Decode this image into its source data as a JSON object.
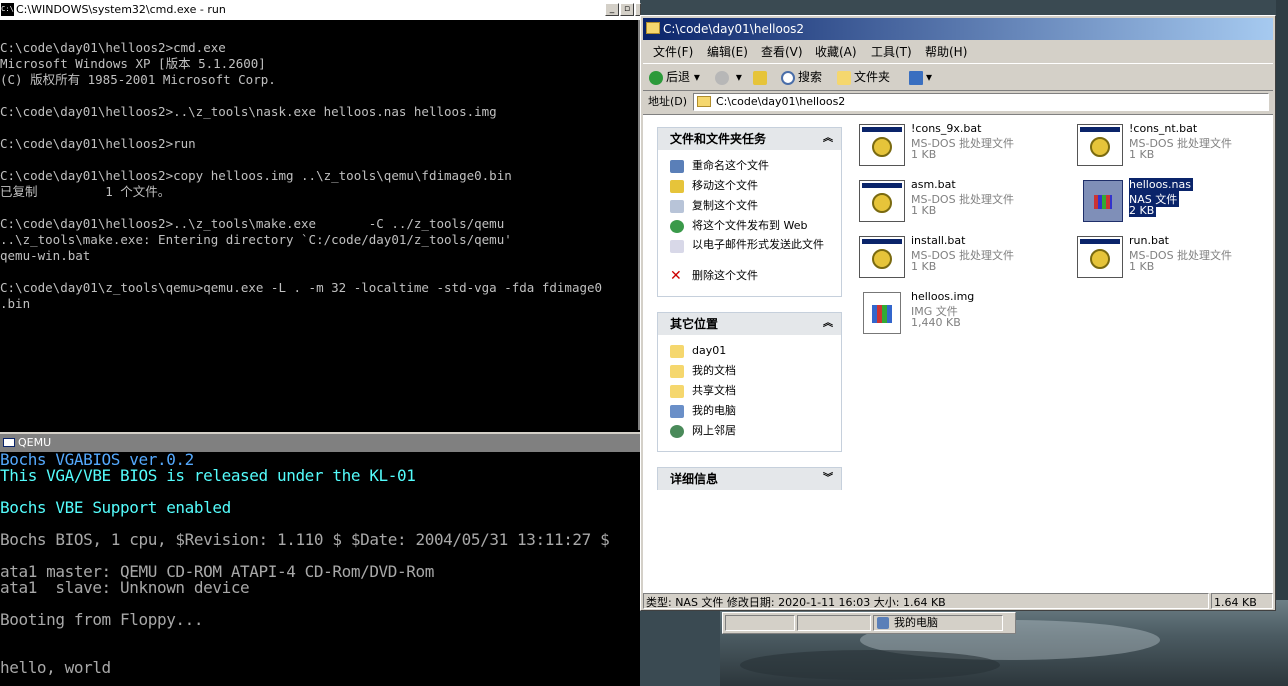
{
  "cmd": {
    "title": "C:\\WINDOWS\\system32\\cmd.exe - run",
    "icon_label": "C:\\",
    "lines": [
      "C:\\code\\day01\\helloos2>cmd.exe",
      "Microsoft Windows XP [版本 5.1.2600]",
      "(C) 版权所有 1985-2001 Microsoft Corp.",
      "",
      "C:\\code\\day01\\helloos2>..\\z_tools\\nask.exe helloos.nas helloos.img",
      "",
      "C:\\code\\day01\\helloos2>run",
      "",
      "C:\\code\\day01\\helloos2>copy helloos.img ..\\z_tools\\qemu\\fdimage0.bin",
      "已复制         1 个文件。",
      "",
      "C:\\code\\day01\\helloos2>..\\z_tools\\make.exe       -C ../z_tools/qemu",
      "..\\z_tools\\make.exe: Entering directory `C:/code/day01/z_tools/qemu'",
      "qemu-win.bat",
      "",
      "C:\\code\\day01\\z_tools\\qemu>qemu.exe -L . -m 32 -localtime -std-vga -fda fdimage0",
      ".bin"
    ]
  },
  "qemu": {
    "title": "QEMU",
    "lines": [
      {
        "text": "Bochs VGABIOS ver.0.2",
        "style": "cyan2"
      },
      {
        "text": "This VGA/VBE BIOS is released under the KL-01",
        "style": "cyan"
      },
      {
        "text": "",
        "style": ""
      },
      {
        "text": "Bochs VBE Support enabled",
        "style": "cyan"
      },
      {
        "text": "",
        "style": ""
      },
      {
        "text": "Bochs BIOS, 1 cpu, $Revision: 1.110 $ $Date: 2004/05/31 13:11:27 $",
        "style": ""
      },
      {
        "text": "",
        "style": ""
      },
      {
        "text": "ata1 master: QEMU CD-ROM ATAPI-4 CD-Rom/DVD-Rom",
        "style": ""
      },
      {
        "text": "ata1  slave: Unknown device",
        "style": ""
      },
      {
        "text": "",
        "style": ""
      },
      {
        "text": "Booting from Floppy...",
        "style": ""
      },
      {
        "text": "",
        "style": ""
      },
      {
        "text": "",
        "style": ""
      },
      {
        "text": "hello, world",
        "style": ""
      }
    ]
  },
  "explorer": {
    "title": "C:\\code\\day01\\helloos2",
    "menu": [
      "文件(F)",
      "编辑(E)",
      "查看(V)",
      "收藏(A)",
      "工具(T)",
      "帮助(H)"
    ],
    "toolbar": {
      "back": "后退",
      "search": "搜索",
      "folders": "文件夹"
    },
    "address_label": "地址(D)",
    "address_value": "C:\\code\\day01\\helloos2",
    "tasks_panel": {
      "title": "文件和文件夹任务",
      "items": [
        "重命名这个文件",
        "移动这个文件",
        "复制这个文件",
        "将这个文件发布到 Web",
        "以电子邮件形式发送此文件",
        "删除这个文件"
      ]
    },
    "places_panel": {
      "title": "其它位置",
      "items": [
        "day01",
        "我的文档",
        "共享文档",
        "我的电脑",
        "网上邻居"
      ]
    },
    "details_panel": {
      "title": "详细信息"
    },
    "files": [
      {
        "name": "!cons_9x.bat",
        "type": "MS-DOS 批处理文件",
        "size": "1 KB",
        "kind": "bat",
        "selected": false
      },
      {
        "name": "!cons_nt.bat",
        "type": "MS-DOS 批处理文件",
        "size": "1 KB",
        "kind": "bat",
        "selected": false
      },
      {
        "name": "asm.bat",
        "type": "MS-DOS 批处理文件",
        "size": "1 KB",
        "kind": "bat",
        "selected": false
      },
      {
        "name": "helloos.nas",
        "type": "NAS 文件",
        "size": "2 KB",
        "kind": "nas",
        "selected": true
      },
      {
        "name": "install.bat",
        "type": "MS-DOS 批处理文件",
        "size": "1 KB",
        "kind": "bat",
        "selected": false
      },
      {
        "name": "run.bat",
        "type": "MS-DOS 批处理文件",
        "size": "1 KB",
        "kind": "bat",
        "selected": false
      },
      {
        "name": "helloos.img",
        "type": "IMG 文件",
        "size": "1,440 KB",
        "kind": "img",
        "selected": false
      }
    ],
    "status_left": "类型: NAS 文件 修改日期: 2020-1-11 16:03 大小: 1.64 KB",
    "status_right": "1.64 KB"
  },
  "taskbar": {
    "my_computer": "我的电脑"
  }
}
